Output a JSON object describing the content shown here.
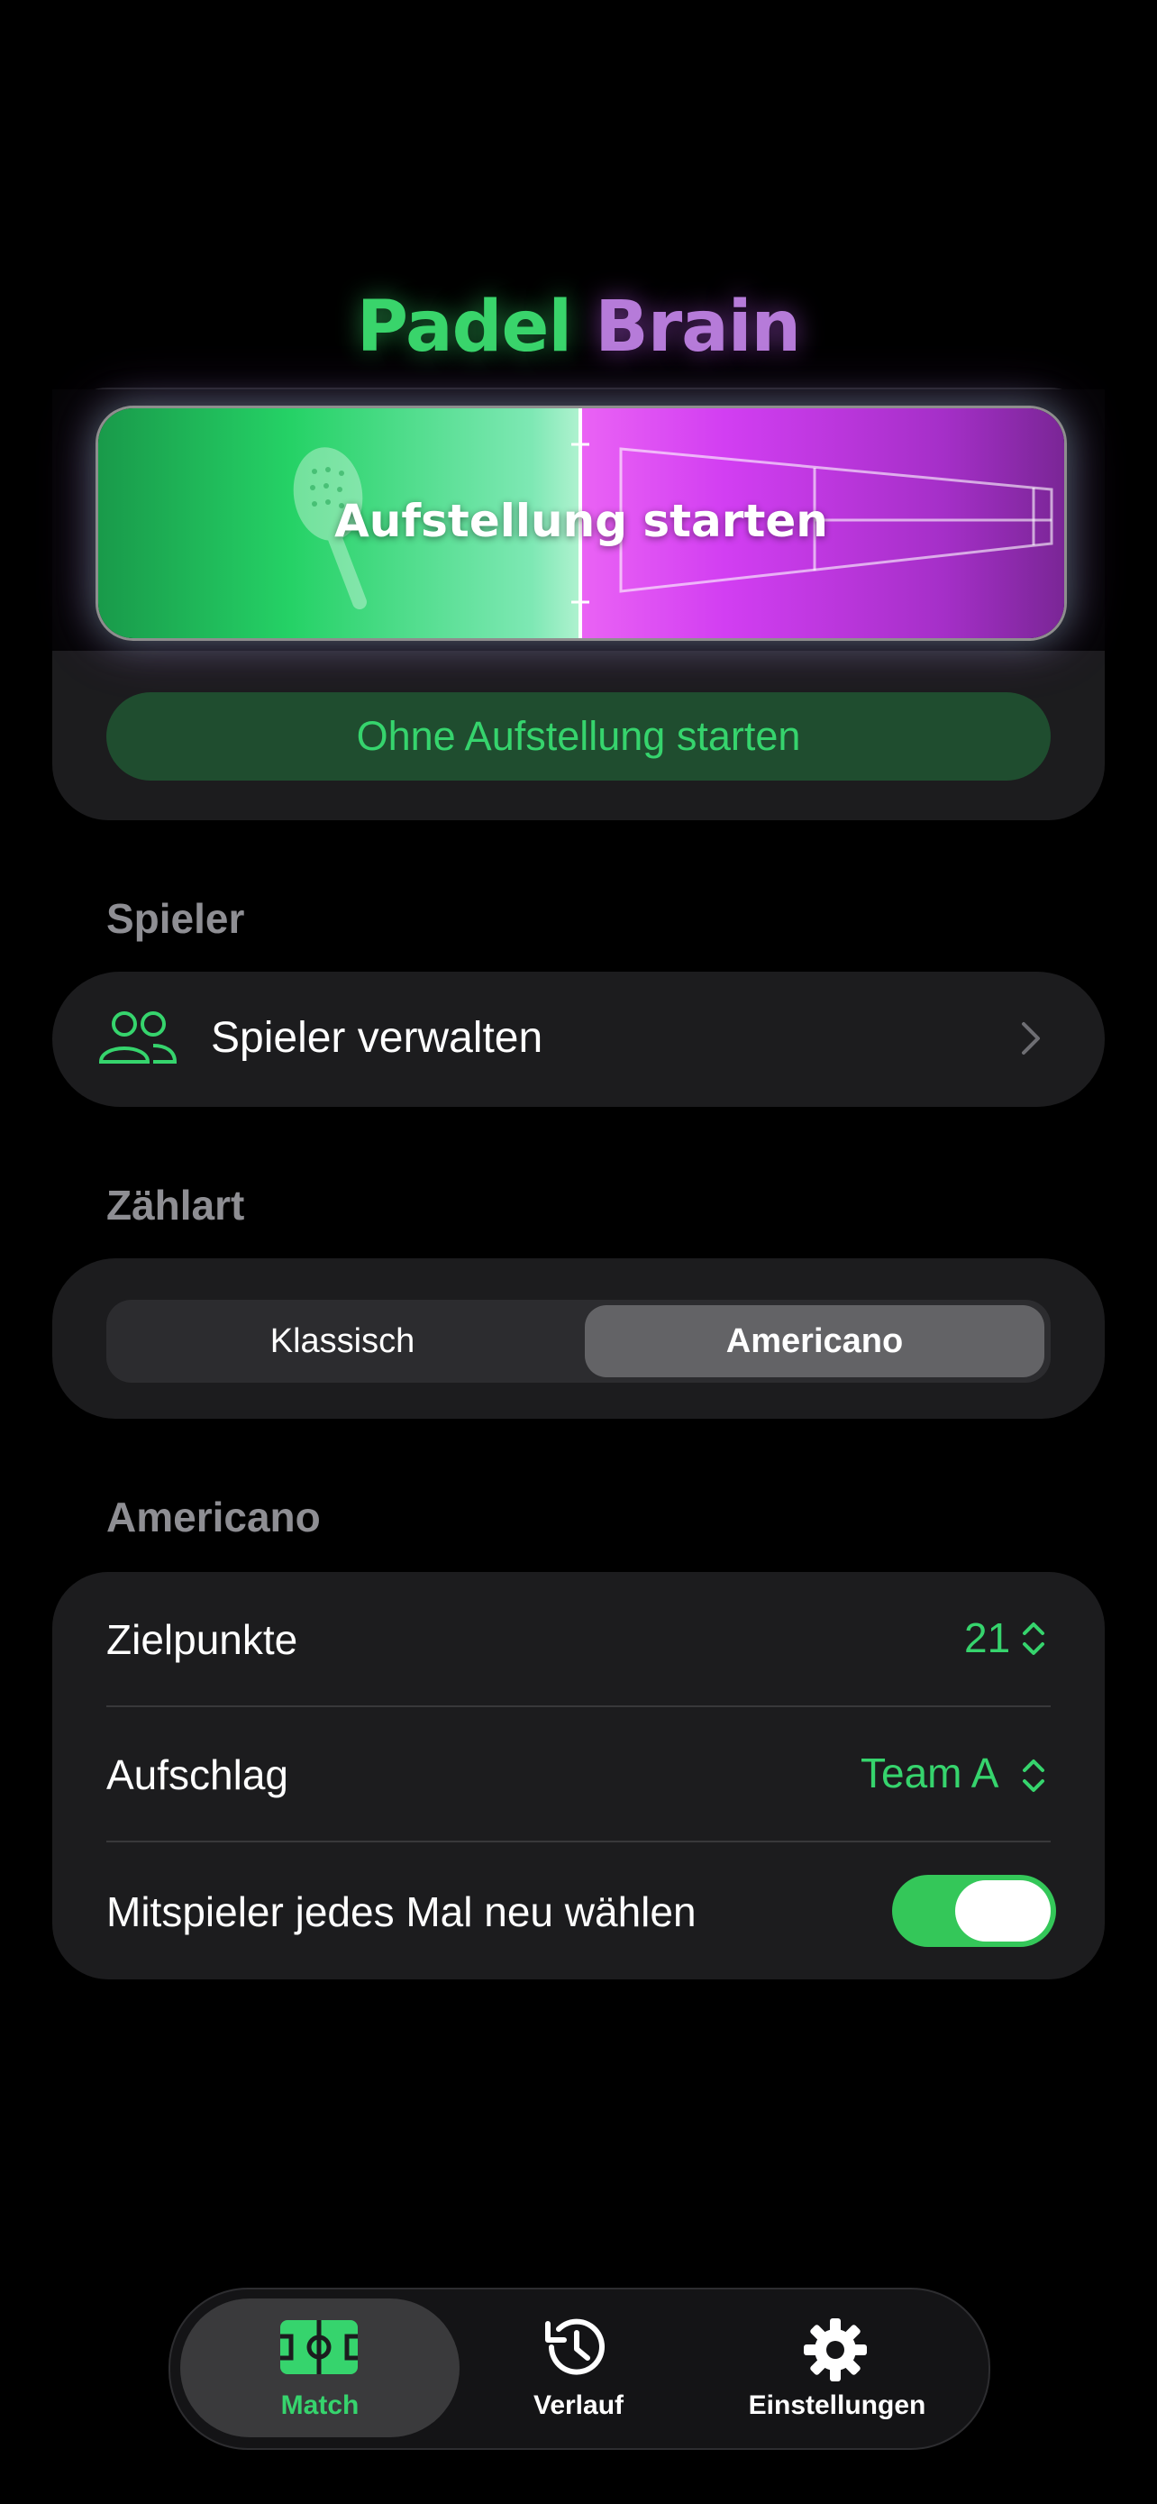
{
  "app": {
    "title_part1": "Padel",
    "title_part2": "Brain"
  },
  "hero": {
    "start_lineup_label": "Aufstellung starten",
    "start_without_lineup_label": "Ohne Aufstellung starten"
  },
  "players": {
    "section_title": "Spieler",
    "manage_label": "Spieler verwalten"
  },
  "scoring": {
    "section_title": "Zählart",
    "options": [
      "Klassisch",
      "Americano"
    ],
    "selected": "Americano"
  },
  "americano": {
    "section_title": "Americano",
    "target_points_label": "Zielpunkte",
    "target_points_value": "21",
    "serve_label": "Aufschlag",
    "serve_value": "Team A",
    "reshuffle_label": "Mitspieler jedes Mal neu wählen",
    "reshuffle_enabled": true
  },
  "tabbar": {
    "tabs": [
      "Match",
      "Verlauf",
      "Einstellungen"
    ],
    "active": "Match"
  },
  "colors": {
    "accent_green": "#36d46d",
    "accent_purple": "#c64af0",
    "card_bg": "#1c1c1e"
  }
}
